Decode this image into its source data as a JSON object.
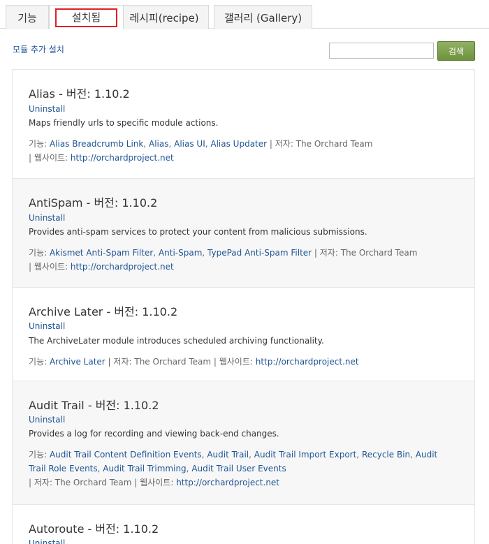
{
  "tabs": [
    {
      "label": "기능"
    },
    {
      "label": "설치됨"
    },
    {
      "label": "레시피(recipe)"
    },
    {
      "label": "갤러리 (Gallery)"
    }
  ],
  "toolbar": {
    "add_module_label": "모듈 추가 설치",
    "search_value": "",
    "search_button_label": "검색"
  },
  "labels": {
    "features": "기능: ",
    "author": " | 저자: ",
    "website": " | 웹사이트: ",
    "comma": ", "
  },
  "modules": [
    {
      "title": "Alias - 버전: 1.10.2",
      "uninstall": "Uninstall",
      "description": "Maps friendly urls to specific module actions.",
      "features": [
        "Alias Breadcrumb Link",
        "Alias",
        "Alias UI",
        "Alias Updater"
      ],
      "author": "The Orchard Team",
      "website": "http://orchardproject.net"
    },
    {
      "title": "AntiSpam - 버전: 1.10.2",
      "uninstall": "Uninstall",
      "description": "Provides anti-spam services to protect your content from malicious submissions.",
      "features": [
        "Akismet Anti-Spam Filter",
        "Anti-Spam",
        "TypePad Anti-Spam Filter"
      ],
      "author": "The Orchard Team",
      "website": "http://orchardproject.net"
    },
    {
      "title": "Archive Later - 버전: 1.10.2",
      "uninstall": "Uninstall",
      "description": "The ArchiveLater module introduces scheduled archiving functionality.",
      "features": [
        "Archive Later"
      ],
      "author": "The Orchard Team",
      "website": "http://orchardproject.net"
    },
    {
      "title": "Audit Trail - 버전: 1.10.2",
      "uninstall": "Uninstall",
      "description": "Provides a log for recording and viewing back-end changes.",
      "features": [
        "Audit Trail Content Definition Events",
        "Audit Trail",
        "Audit Trail Import Export",
        "Recycle Bin",
        "Audit Trail Role Events",
        "Audit Trail Trimming",
        "Audit Trail User Events"
      ],
      "author": "The Orchard Team",
      "website": "http://orchardproject.net"
    },
    {
      "title": "Autoroute - 버전: 1.10.2",
      "uninstall": "Uninstall",
      "description": "",
      "features": [],
      "author": "",
      "website": ""
    }
  ]
}
